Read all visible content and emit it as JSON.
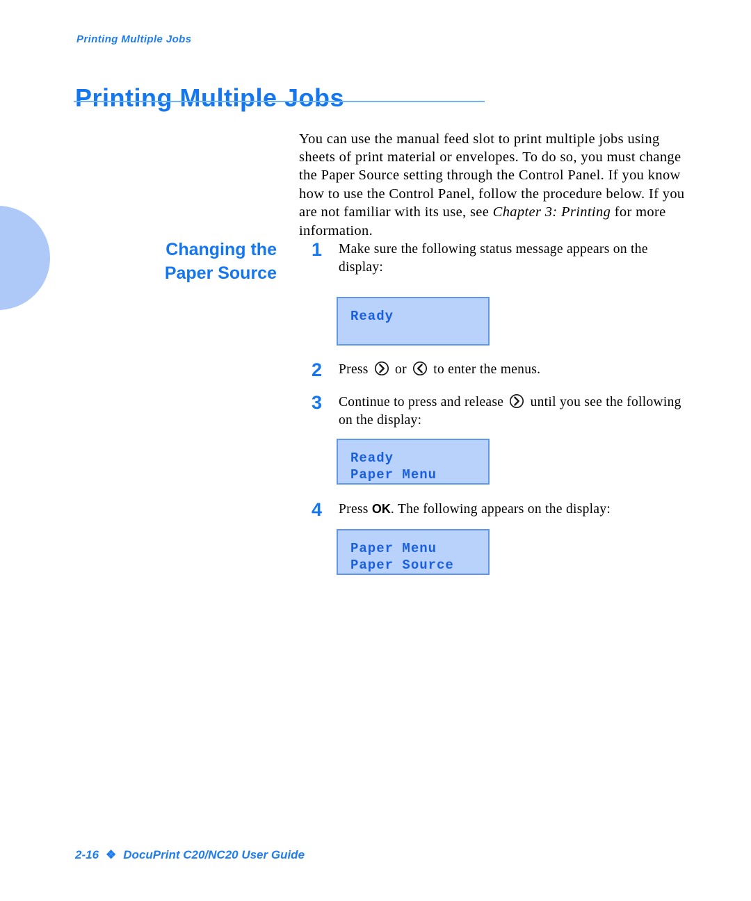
{
  "running_head": "Printing Multiple Jobs",
  "title": "Printing Multiple Jobs",
  "intro": {
    "part1": "You can use the manual feed slot to print multiple jobs using sheets of print material or envelopes. To do so, you must change the Paper Source setting through the Control Panel. If you know how to use the Control Panel, follow the procedure below. If you are not familiar with its use, see ",
    "emphasis": "Chapter 3: Printing",
    "part2": " for more information."
  },
  "side_heading": {
    "line1": "Changing the",
    "line2": "Paper Source"
  },
  "steps": [
    {
      "number": "1",
      "text": "Make sure the following status message appears on the display:"
    },
    {
      "number": "2",
      "text_before": "Press ",
      "text_middle": " or ",
      "text_after": " to enter the menus."
    },
    {
      "number": "3",
      "text_before": "Continue to press and release ",
      "text_after": " until you see the following on the display:"
    },
    {
      "number": "4",
      "text_before": "Press ",
      "ok_label": "OK",
      "text_after": ". The following appears on the display:"
    }
  ],
  "displays": [
    {
      "line1": "Ready",
      "line2": ""
    },
    {
      "line1": "Ready",
      "line2": "Paper Menu"
    },
    {
      "line1": "Paper Menu",
      "line2": "Paper Source"
    }
  ],
  "icons": {
    "right_arrow": "right-arrow-key-icon",
    "left_arrow": "left-arrow-key-icon"
  },
  "footer": {
    "page_number": "2-16",
    "separator": "❖",
    "guide_title": "DocuPrint C20/NC20 User Guide"
  },
  "colors": {
    "heading_blue": "#1577ef",
    "rule_blue": "#6eb4f7",
    "tab_blue": "#aec8f7",
    "lcd_fill": "#b9d2fb",
    "lcd_border": "#5f96ea",
    "lcd_text": "#1a5fe0"
  }
}
